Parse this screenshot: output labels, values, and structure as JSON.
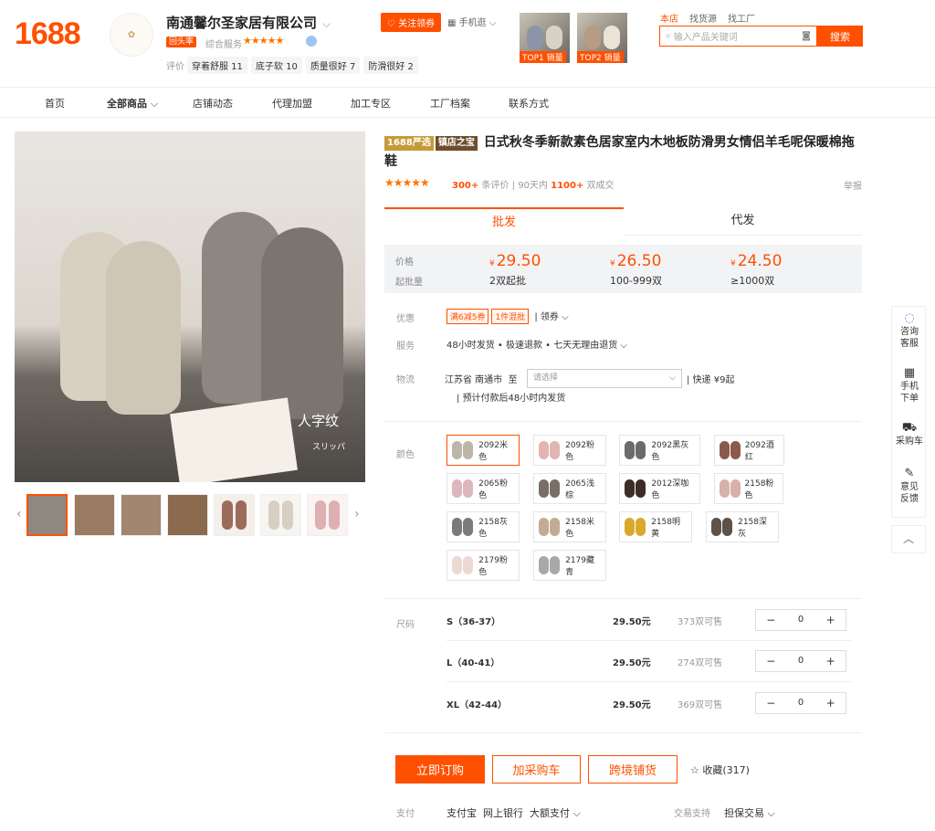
{
  "header": {
    "logo": "1688",
    "shop_name": "南通馨尔圣家居有限公司",
    "shop_badge": "回头率",
    "shop_rating_label": "综合服务",
    "shop_stars": "★★★★★",
    "review_label": "评价",
    "review_tags": [
      "穿着舒服 11",
      "底子软 10",
      "质量很好 7",
      "防滑很好 2"
    ],
    "follow_label": "关注领券",
    "phone_label": "手机逛",
    "top_products": [
      {
        "caption": "TOP1 销量"
      },
      {
        "caption": "TOP2 销量"
      }
    ],
    "search_tabs": [
      "本店",
      "找货源",
      "找工厂"
    ],
    "search_placeholder": "输入产品关键词",
    "search_button": "搜索"
  },
  "nav": {
    "items": [
      "首页",
      "全部商品",
      "店铺动态",
      "代理加盟",
      "加工专区",
      "工厂档案",
      "联系方式"
    ]
  },
  "gallery": {
    "overlay_text": "人字纹",
    "overlay_sub": "スリッパ"
  },
  "product": {
    "badge_1688": "1688严选",
    "badge_shop": "镇店之宝",
    "title": "日式秋冬季新款素色居家室内木地板防滑男女情侣羊毛呢保暖棉拖鞋",
    "stars": "★★★★★",
    "review_count": "300+",
    "review_suffix": "条评价",
    "sold_prefix": "90天内",
    "sold_count": "1100+",
    "sold_suffix": "双成交",
    "report_label": "举报",
    "tabs": [
      "批发",
      "代发"
    ],
    "price_label": "价格",
    "moq_label": "起批量",
    "currency": "¥",
    "tiers": [
      {
        "price": "29.50",
        "qty": "2双起批"
      },
      {
        "price": "26.50",
        "qty": "100-999双"
      },
      {
        "price": "24.50",
        "qty": "≥1000双"
      }
    ],
    "promo_label": "优惠",
    "promo_tags": [
      "满6减5券",
      "1件混批"
    ],
    "promo_coupon": "领券",
    "service_label": "服务",
    "service_text": "48小时发货 • 极速退款 • 七天无理由退货",
    "logistics_label": "物流",
    "logistics_from": "江苏省 南通市",
    "logistics_to": "至",
    "logistics_select_placeholder": "请选择",
    "logistics_fee": "快递 ¥9起",
    "logistics_note": "预计付款后48小时内发货",
    "color_label": "颜色",
    "colors": [
      {
        "name": "2092米色",
        "c": "#bdb6a8"
      },
      {
        "name": "2092粉色",
        "c": "#e2b4b4"
      },
      {
        "name": "2092黑灰色",
        "c": "#6b6b6b"
      },
      {
        "name": "2092酒红",
        "c": "#8a5a4c"
      },
      {
        "name": "2065粉色",
        "c": "#dcb7bd"
      },
      {
        "name": "2065浅棕",
        "c": "#7a6e66"
      },
      {
        "name": "2012深咖色",
        "c": "#3d2d26"
      },
      {
        "name": "2158粉色",
        "c": "#d8b0ac"
      },
      {
        "name": "2158灰色",
        "c": "#7b7b7b"
      },
      {
        "name": "2158米色",
        "c": "#c3ab93"
      },
      {
        "name": "2158明黄",
        "c": "#d9a92e"
      },
      {
        "name": "2158深灰",
        "c": "#5e5147"
      },
      {
        "name": "2179粉色",
        "c": "#ecd9d4"
      },
      {
        "name": "2179藏青",
        "c": "#a8a8a8"
      }
    ],
    "size_label": "尺码",
    "sizes": [
      {
        "name": "S（36-37）",
        "price": "29.50元",
        "stock": "373双可售",
        "qty": "0"
      },
      {
        "name": "L（40-41）",
        "price": "29.50元",
        "stock": "274双可售",
        "qty": "0"
      },
      {
        "name": "XL（42-44）",
        "price": "29.50元",
        "stock": "369双可售",
        "qty": "0"
      }
    ],
    "buy_label": "立即订购",
    "cart_label": "加采购车",
    "cross_label": "跨境铺货",
    "favorite_label": "收藏(317)",
    "pay_label": "支付",
    "pay_methods": "支付宝  网上银行  大额支付",
    "trade_label": "交易支持",
    "trade_value": "担保交易"
  },
  "sidebar": {
    "items": [
      "咨询客服",
      "手机下单",
      "采购车",
      "意见反馈"
    ]
  }
}
